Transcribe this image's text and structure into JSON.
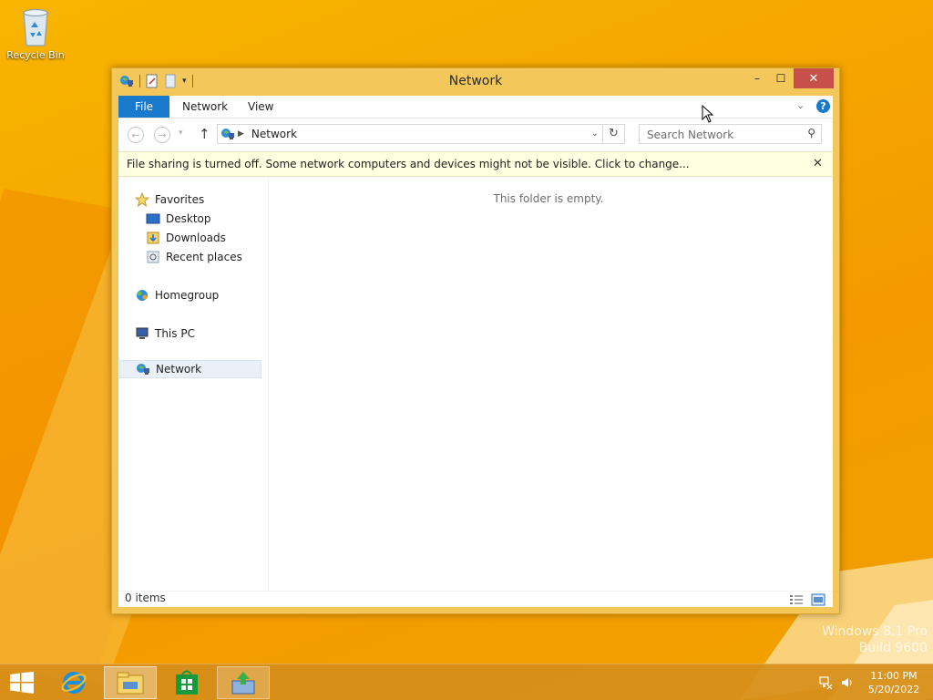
{
  "desktop": {
    "recycle_bin_label": "Recycle Bin",
    "watermark_line1": "Windows 8.1 Pro",
    "watermark_line2": "Build 9600"
  },
  "window": {
    "title": "Network",
    "controls": {
      "minimize": "–",
      "maximize": "☐",
      "close": "✕"
    }
  },
  "ribbon": {
    "tabs": [
      {
        "label": "File"
      },
      {
        "label": "Network"
      },
      {
        "label": "View"
      }
    ],
    "help_label": "?"
  },
  "address_bar": {
    "path": "Network",
    "back_label": "←",
    "forward_label": "→",
    "up_label": "↑",
    "refresh_label": "↻"
  },
  "search": {
    "placeholder": "Search Network"
  },
  "infobar": {
    "message": "File sharing is turned off. Some network computers and devices might not be visible. Click to change...",
    "close_label": "✕"
  },
  "navigation": {
    "favorites": "Favorites",
    "desktop": "Desktop",
    "downloads": "Downloads",
    "recent_places": "Recent places",
    "homegroup": "Homegroup",
    "this_pc": "This PC",
    "network": "Network"
  },
  "content": {
    "empty_message": "This folder is empty."
  },
  "status": {
    "item_count": "0 items"
  },
  "taskbar": {
    "clock_time": "11:00 PM",
    "clock_date": "5/20/2022"
  },
  "colors": {
    "desktop_background": "#f6a800",
    "window_frame": "#f3c75a",
    "file_tab": "#1979ca",
    "close_button": "#c7504a",
    "infobar_background": "#ffffe1"
  }
}
